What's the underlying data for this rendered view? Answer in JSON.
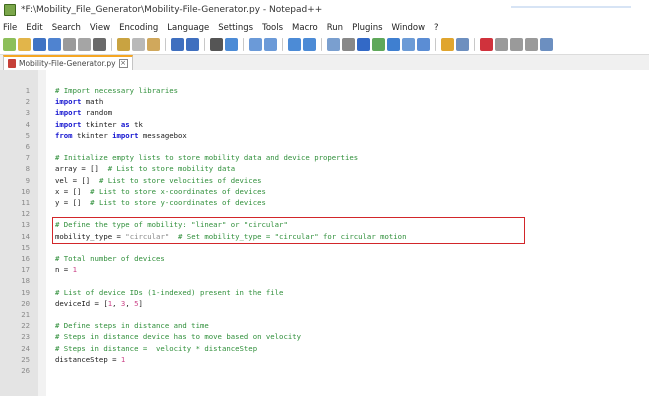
{
  "window": {
    "title": "*F:\\Mobility_File_Generator\\Mobility-File-Generator.py - Notepad++"
  },
  "menu": [
    "File",
    "Edit",
    "Search",
    "View",
    "Encoding",
    "Language",
    "Settings",
    "Tools",
    "Macro",
    "Run",
    "Plugins",
    "Window",
    "?"
  ],
  "tab": {
    "label": "Mobility-File-Generator.py"
  },
  "lines": [
    {
      "n": "1",
      "segs": [
        {
          "t": "# Import necessary libraries",
          "c": "cm"
        }
      ]
    },
    {
      "n": "2",
      "segs": [
        {
          "t": "import",
          "c": "kw"
        },
        {
          "t": " math",
          "c": ""
        }
      ]
    },
    {
      "n": "3",
      "segs": [
        {
          "t": "import",
          "c": "kw"
        },
        {
          "t": " random",
          "c": ""
        }
      ]
    },
    {
      "n": "4",
      "segs": [
        {
          "t": "import",
          "c": "kw"
        },
        {
          "t": " tkinter ",
          "c": ""
        },
        {
          "t": "as",
          "c": "kw"
        },
        {
          "t": " tk",
          "c": ""
        }
      ]
    },
    {
      "n": "5",
      "segs": [
        {
          "t": "from",
          "c": "kw"
        },
        {
          "t": " tkinter ",
          "c": ""
        },
        {
          "t": "import",
          "c": "kw"
        },
        {
          "t": " messagebox",
          "c": ""
        }
      ]
    },
    {
      "n": "6",
      "segs": []
    },
    {
      "n": "7",
      "segs": [
        {
          "t": "# Initialize empty lists to store mobility data and device properties",
          "c": "cm"
        }
      ]
    },
    {
      "n": "8",
      "segs": [
        {
          "t": "array = [] ",
          "c": ""
        },
        {
          "t": " # List to store mobility data",
          "c": "cm"
        }
      ]
    },
    {
      "n": "9",
      "segs": [
        {
          "t": "vel = [] ",
          "c": ""
        },
        {
          "t": " # List to store velocities of devices",
          "c": "cm"
        }
      ]
    },
    {
      "n": "10",
      "segs": [
        {
          "t": "x = [] ",
          "c": ""
        },
        {
          "t": " # List to store x-coordinates of devices",
          "c": "cm"
        }
      ]
    },
    {
      "n": "11",
      "segs": [
        {
          "t": "y = [] ",
          "c": ""
        },
        {
          "t": " # List to store y-coordinates of devices",
          "c": "cm"
        }
      ]
    },
    {
      "n": "12",
      "segs": []
    },
    {
      "n": "13",
      "segs": [
        {
          "t": "# Define the type of mobility: \"linear\" or \"circular\"",
          "c": "cm"
        }
      ]
    },
    {
      "n": "14",
      "segs": [
        {
          "t": "mobility_type = ",
          "c": ""
        },
        {
          "t": "\"circular\"",
          "c": "str"
        },
        {
          "t": "  # Set mobility_type = \"circular\" for circular motion",
          "c": "cm"
        }
      ]
    },
    {
      "n": "15",
      "segs": []
    },
    {
      "n": "16",
      "segs": [
        {
          "t": "# Total number of devices",
          "c": "cm"
        }
      ]
    },
    {
      "n": "17",
      "segs": [
        {
          "t": "n = ",
          "c": ""
        },
        {
          "t": "1",
          "c": "num"
        }
      ]
    },
    {
      "n": "18",
      "segs": []
    },
    {
      "n": "19",
      "segs": [
        {
          "t": "# List of device IDs (1-indexed) present in the file",
          "c": "cm"
        }
      ]
    },
    {
      "n": "20",
      "segs": [
        {
          "t": "deviceId = [",
          "c": ""
        },
        {
          "t": "1",
          "c": "num"
        },
        {
          "t": ", ",
          "c": ""
        },
        {
          "t": "3",
          "c": "num"
        },
        {
          "t": ", ",
          "c": ""
        },
        {
          "t": "5",
          "c": "num"
        },
        {
          "t": "]",
          "c": ""
        }
      ]
    },
    {
      "n": "21",
      "segs": []
    },
    {
      "n": "22",
      "segs": [
        {
          "t": "# Define steps in distance and time",
          "c": "cm"
        }
      ]
    },
    {
      "n": "23",
      "segs": [
        {
          "t": "# Steps in distance device has to move based on velocity",
          "c": "cm"
        }
      ]
    },
    {
      "n": "24",
      "segs": [
        {
          "t": "# Steps in distance =  velocity * distanceStep",
          "c": "cm"
        }
      ]
    },
    {
      "n": "25",
      "segs": [
        {
          "t": "distanceStep = ",
          "c": ""
        },
        {
          "t": "1",
          "c": "num"
        }
      ]
    },
    {
      "n": "26",
      "segs": []
    }
  ],
  "highlight": {
    "from_line": 13,
    "to_line": 14,
    "color": "#d2262a"
  },
  "colors": {
    "comment": "#2f8f3a",
    "keyword": "#1515d0",
    "string": "#8a8a8a",
    "number": "#cc4488",
    "tab_accent": "#f5a623"
  }
}
